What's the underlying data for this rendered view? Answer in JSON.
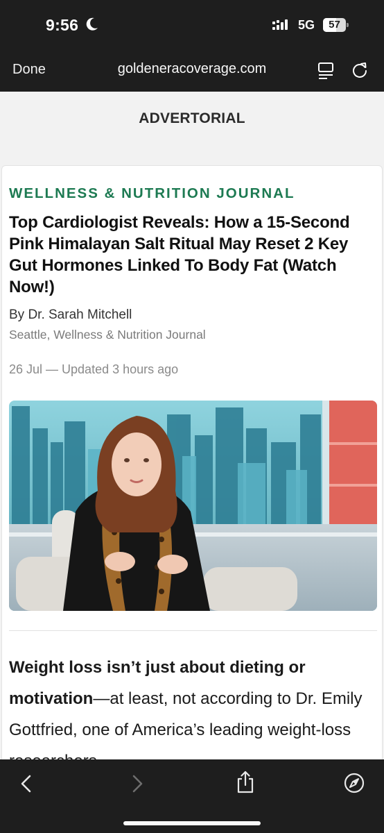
{
  "status": {
    "time": "9:56",
    "network": "5G",
    "battery": "57",
    "battery_level": 0.57
  },
  "browser": {
    "done_label": "Done",
    "url": "goldeneracoverage.com"
  },
  "page": {
    "banner": "ADVERTORIAL",
    "article": {
      "kicker": "WELLNESS & NUTRITION JOURNAL",
      "headline": "Top Cardiologist Reveals: How a 15-Second Pink Himalayan Salt Ritual May Reset 2 Key Gut Hormones Linked To Body Fat (Watch Now!)",
      "byline": "By Dr. Sarah Mitchell",
      "location": "Seattle, Wellness & Nutrition Journal",
      "date": "26 Jul — Updated 3 hours ago",
      "body_bold": "Weight loss isn’t just about dieting or motivation",
      "body_rest": "—at least, not according to Dr. Emily Gottfried, one of America’s leading weight-loss researchers."
    }
  },
  "colors": {
    "kicker": "#1d7a52",
    "chrome": "#1e1e1e",
    "page_bg": "#f2f2f2"
  },
  "icons": {
    "moon": "moon-icon",
    "signal": "signal-icon",
    "reader": "reader-mode-icon",
    "reload": "reload-icon",
    "back": "chevron-left-icon",
    "forward": "chevron-right-icon",
    "share": "share-icon",
    "compass": "compass-icon"
  }
}
